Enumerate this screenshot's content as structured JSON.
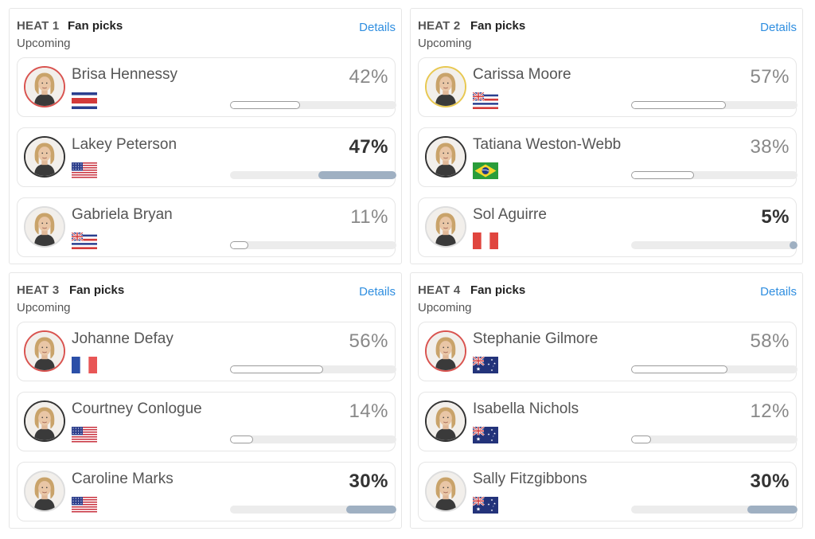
{
  "heats": [
    {
      "label": "HEAT 1",
      "sub": "Fan picks",
      "status": "Upcoming",
      "details": "Details",
      "surfers": [
        {
          "name": "Brisa Hennessy",
          "pct": "42%",
          "value": 42,
          "leader": false,
          "ring": "#d9534f",
          "flag": "costa-rica"
        },
        {
          "name": "Lakey Peterson",
          "pct": "47%",
          "value": 47,
          "leader": true,
          "ring": "#333333",
          "flag": "usa"
        },
        {
          "name": "Gabriela Bryan",
          "pct": "11%",
          "value": 11,
          "leader": false,
          "ring": "#dddddd",
          "flag": "hawaii"
        }
      ]
    },
    {
      "label": "HEAT 2",
      "sub": "Fan picks",
      "status": "Upcoming",
      "details": "Details",
      "surfers": [
        {
          "name": "Carissa Moore",
          "pct": "57%",
          "value": 57,
          "leader": false,
          "ring": "#e8c850",
          "flag": "hawaii"
        },
        {
          "name": "Tatiana Weston-Webb",
          "pct": "38%",
          "value": 38,
          "leader": false,
          "ring": "#333333",
          "flag": "brazil"
        },
        {
          "name": "Sol Aguirre",
          "pct": "5%",
          "value": 5,
          "leader": true,
          "ring": "#dddddd",
          "flag": "peru"
        }
      ]
    },
    {
      "label": "HEAT 3",
      "sub": "Fan picks",
      "status": "Upcoming",
      "details": "Details",
      "surfers": [
        {
          "name": "Johanne Defay",
          "pct": "56%",
          "value": 56,
          "leader": false,
          "ring": "#d9534f",
          "flag": "france"
        },
        {
          "name": "Courtney Conlogue",
          "pct": "14%",
          "value": 14,
          "leader": false,
          "ring": "#333333",
          "flag": "usa"
        },
        {
          "name": "Caroline Marks",
          "pct": "30%",
          "value": 30,
          "leader": true,
          "ring": "#dddddd",
          "flag": "usa"
        }
      ]
    },
    {
      "label": "HEAT 4",
      "sub": "Fan picks",
      "status": "Upcoming",
      "details": "Details",
      "surfers": [
        {
          "name": "Stephanie Gilmore",
          "pct": "58%",
          "value": 58,
          "leader": false,
          "ring": "#d9534f",
          "flag": "australia"
        },
        {
          "name": "Isabella Nichols",
          "pct": "12%",
          "value": 12,
          "leader": false,
          "ring": "#333333",
          "flag": "australia"
        },
        {
          "name": "Sally Fitzgibbons",
          "pct": "30%",
          "value": 30,
          "leader": true,
          "ring": "#dddddd",
          "flag": "australia"
        }
      ]
    }
  ]
}
